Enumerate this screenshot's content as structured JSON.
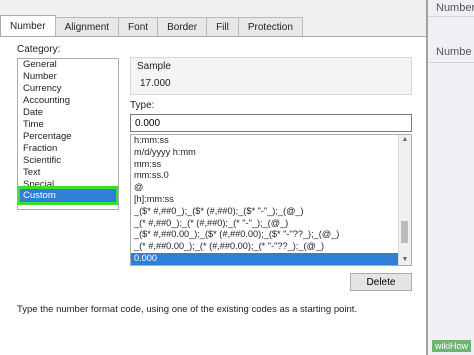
{
  "background": {
    "right_header": "Number",
    "right_label": "Numbe"
  },
  "dialog": {
    "tabs": [
      {
        "label": "Number",
        "active": true
      },
      {
        "label": "Alignment"
      },
      {
        "label": "Font"
      },
      {
        "label": "Border"
      },
      {
        "label": "Fill"
      },
      {
        "label": "Protection"
      }
    ],
    "category_label": "Category:",
    "categories": [
      "General",
      "Number",
      "Currency",
      "Accounting",
      "Date",
      "Time",
      "Percentage",
      "Fraction",
      "Scientific",
      "Text",
      "Special",
      "Custom"
    ],
    "selected_category": "Custom",
    "sample": {
      "legend": "Sample",
      "value": "17.000"
    },
    "type_label": "Type:",
    "type_value": "0.000",
    "formats": [
      "h:mm:ss",
      "m/d/yyyy h:mm",
      "mm:ss",
      "mm:ss.0",
      "@",
      "[h]:mm:ss",
      "_($* #,##0_);_($* (#,##0);_($* \"-\"_);_(@_)",
      "_(* #,##0_);_(* (#,##0);_(* \"-\"_);_(@_)",
      "_($* #,##0.00_);_($* (#,##0.00);_($* \"-\"??_);_(@_)",
      "_(* #,##0.00_);_(* (#,##0.00);_(* \"-\"??_);_(@_)",
      "0.000"
    ],
    "selected_format": "0.000",
    "delete_label": "Delete",
    "hint": "Type the number format code, using one of the existing codes as a starting point."
  },
  "watermark": "wikiHow",
  "colors": {
    "selection": "#2f7fd8",
    "highlight_outline": "#38e02a",
    "watermark_bg": "#6db66f"
  }
}
